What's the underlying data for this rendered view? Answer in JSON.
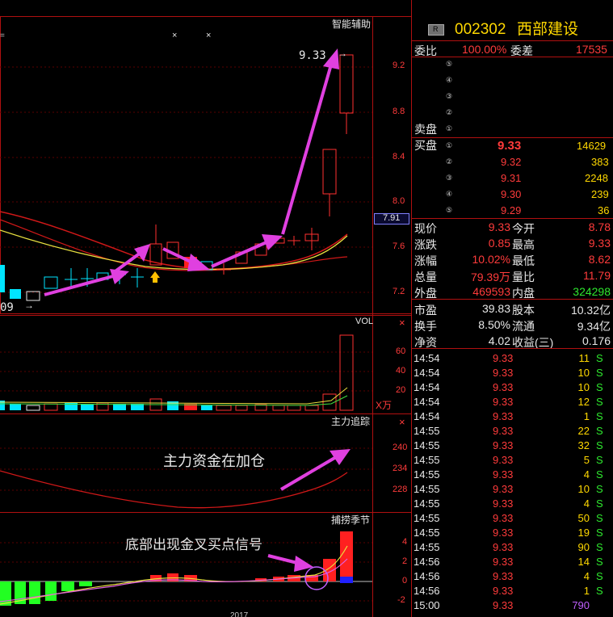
{
  "chart_panels": {
    "price": {
      "label": "智能辅助",
      "axis": [
        "9.2",
        "8.8",
        "8.4",
        "8.0",
        "7.6",
        "7.2"
      ],
      "current_tag": "7.91",
      "high_label": "9.33",
      "low_label": "09",
      "close_x": "×",
      "close_x2": "×",
      "mini_text": "="
    },
    "volume": {
      "label": "VOL",
      "axis": [
        "60",
        "40",
        "20"
      ],
      "unit": "X万",
      "close": "×"
    },
    "main_force": {
      "label": "主力追踪",
      "axis": [
        "240",
        "234",
        "228"
      ],
      "close": "×",
      "annotation": "主力资金在加仓"
    },
    "season": {
      "label": "捕捞季节",
      "axis": [
        "4",
        "2",
        "0",
        "-2"
      ],
      "annotation": "底部出现金叉买点信号"
    },
    "bottom_year": "2017"
  },
  "quote": {
    "badge": "R",
    "code": "002302",
    "name": "西部建设",
    "weibi_label": "委比",
    "weibi": "100.00%",
    "weicha_label": "委差",
    "weicha": "17535",
    "sell_label": "卖盘",
    "buy_label": "买盘",
    "sell_levels": [
      "⑤",
      "④",
      "③",
      "②",
      "①"
    ],
    "buy": [
      {
        "lvl": "①",
        "price": "9.33",
        "vol": "14629"
      },
      {
        "lvl": "②",
        "price": "9.32",
        "vol": "383"
      },
      {
        "lvl": "③",
        "price": "9.31",
        "vol": "2248"
      },
      {
        "lvl": "④",
        "price": "9.30",
        "vol": "239"
      },
      {
        "lvl": "⑤",
        "price": "9.29",
        "vol": "36"
      }
    ],
    "stats": [
      {
        "l1": "现价",
        "v1": "9.33",
        "l2": "今开",
        "v2": "8.78"
      },
      {
        "l1": "涨跌",
        "v1": "0.85",
        "l2": "最高",
        "v2": "9.33"
      },
      {
        "l1": "涨幅",
        "v1": "10.02%",
        "l2": "最低",
        "v2": "8.62"
      },
      {
        "l1": "总量",
        "v1": "79.39万",
        "l2": "量比",
        "v2": "11.79"
      },
      {
        "l1": "外盘",
        "v1": "469593",
        "l2": "内盘",
        "v2": "324298"
      }
    ],
    "stats2": [
      {
        "l1": "市盈",
        "v1": "39.83",
        "l2": "股本",
        "v2": "10.32亿"
      },
      {
        "l1": "换手",
        "v1": "8.50%",
        "l2": "流通",
        "v2": "9.34亿"
      },
      {
        "l1": "净资",
        "v1": "4.02",
        "l2": "收益(三)",
        "v2": "0.176"
      }
    ]
  },
  "ticks": [
    {
      "t": "14:54",
      "p": "9.33",
      "v": "11",
      "s": "S"
    },
    {
      "t": "14:54",
      "p": "9.33",
      "v": "10",
      "s": "S"
    },
    {
      "t": "14:54",
      "p": "9.33",
      "v": "10",
      "s": "S"
    },
    {
      "t": "14:54",
      "p": "9.33",
      "v": "12",
      "s": "S"
    },
    {
      "t": "14:54",
      "p": "9.33",
      "v": "1",
      "s": "S"
    },
    {
      "t": "14:55",
      "p": "9.33",
      "v": "22",
      "s": "S"
    },
    {
      "t": "14:55",
      "p": "9.33",
      "v": "32",
      "s": "S"
    },
    {
      "t": "14:55",
      "p": "9.33",
      "v": "5",
      "s": "S"
    },
    {
      "t": "14:55",
      "p": "9.33",
      "v": "4",
      "s": "S"
    },
    {
      "t": "14:55",
      "p": "9.33",
      "v": "10",
      "s": "S"
    },
    {
      "t": "14:55",
      "p": "9.33",
      "v": "4",
      "s": "S"
    },
    {
      "t": "14:55",
      "p": "9.33",
      "v": "50",
      "s": "S"
    },
    {
      "t": "14:55",
      "p": "9.33",
      "v": "19",
      "s": "S"
    },
    {
      "t": "14:55",
      "p": "9.33",
      "v": "90",
      "s": "S"
    },
    {
      "t": "14:56",
      "p": "9.33",
      "v": "14",
      "s": "S"
    },
    {
      "t": "14:56",
      "p": "9.33",
      "v": "4",
      "s": "S"
    },
    {
      "t": "14:56",
      "p": "9.33",
      "v": "1",
      "s": "S"
    },
    {
      "t": "15:00",
      "p": "9.33",
      "v": "790",
      "s": ""
    }
  ]
}
